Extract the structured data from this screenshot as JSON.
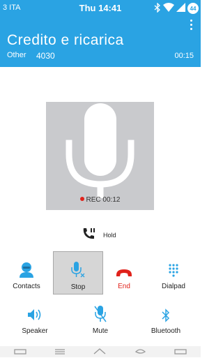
{
  "statusbar": {
    "carrier": "3 ITA",
    "time": "Thu 14:41",
    "battery": "44"
  },
  "header": {
    "title": "Credito e ricarica",
    "label": "Other",
    "number": "4030",
    "timer": "00:15"
  },
  "recording": {
    "text": "REC 00:12"
  },
  "hold": {
    "label": "Hold"
  },
  "actions_row1": [
    {
      "label": "Contacts",
      "icon": "contacts-icon"
    },
    {
      "label": "Stop",
      "icon": "mic-off-icon"
    },
    {
      "label": "End",
      "icon": "hangup-icon"
    },
    {
      "label": "Dialpad",
      "icon": "dialpad-icon"
    }
  ],
  "actions_row2": [
    {
      "label": "Speaker",
      "icon": "speaker-icon"
    },
    {
      "label": "Mute",
      "icon": "mute-icon"
    },
    {
      "label": "Bluetooth",
      "icon": "bluetooth-icon"
    }
  ],
  "colors": {
    "accent": "#2aa3e3",
    "end": "#e0221b",
    "panel": "#c9cacd"
  }
}
